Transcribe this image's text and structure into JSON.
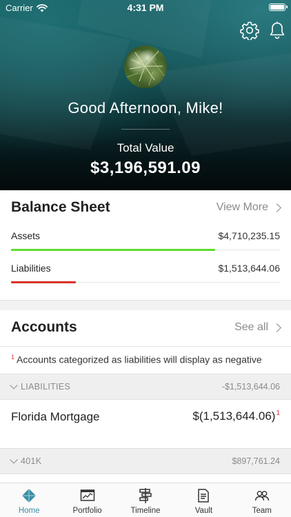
{
  "status_bar": {
    "carrier": "Carrier",
    "time": "4:31 PM"
  },
  "header": {
    "greeting": "Good Afternoon, Mike!",
    "total_label": "Total Value",
    "total_value": "$3,196,591.09",
    "icons": [
      "gear-icon",
      "bell-icon"
    ]
  },
  "balance_sheet": {
    "title": "Balance Sheet",
    "link_label": "View More",
    "rows": [
      {
        "label": "Assets",
        "value": "$4,710,235.15",
        "bar_fraction": 0.76,
        "color": "#5ddc2e"
      },
      {
        "label": "Liabilities",
        "value": "$1,513,644.06",
        "bar_fraction": 0.24,
        "color": "#d8332a"
      }
    ]
  },
  "accounts": {
    "title": "Accounts",
    "link_label": "See all",
    "note_marker": "1",
    "note": "Accounts categorized as liabilities will display as negative",
    "groups": [
      {
        "name": "LIABILITIES",
        "value": "-$1,513,644.06",
        "accounts": [
          {
            "name": "Florida Mortgage",
            "value": "$(1,513,644.06)",
            "marker": "1"
          }
        ]
      },
      {
        "name": "401K",
        "value": "$897,761.24",
        "accounts": []
      }
    ]
  },
  "tabbar": {
    "active": "Home",
    "accent": "#3a8fa7",
    "tabs": [
      {
        "label": "Home",
        "icon": "home-diamond-icon"
      },
      {
        "label": "Portfolio",
        "icon": "portfolio-chart-icon"
      },
      {
        "label": "Timeline",
        "icon": "timeline-icon"
      },
      {
        "label": "Vault",
        "icon": "vault-document-icon"
      },
      {
        "label": "Team",
        "icon": "team-icon"
      }
    ]
  }
}
